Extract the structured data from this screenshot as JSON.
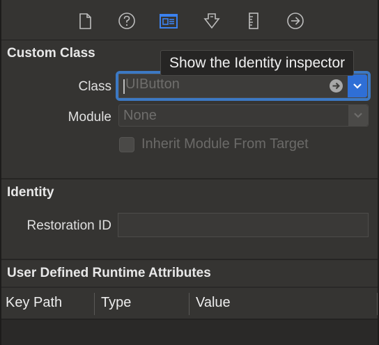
{
  "tabs": {
    "file_inspector": "file-icon",
    "quick_help": "help-icon",
    "identity_inspector": "identity-icon",
    "attributes_inspector": "attributes-icon",
    "size_inspector": "ruler-icon",
    "connections_inspector": "arrow-circle-icon"
  },
  "tooltip": "Show the Identity inspector",
  "custom_class": {
    "title": "Custom Class",
    "class_label": "Class",
    "class_placeholder": "UIButton",
    "module_label": "Module",
    "module_placeholder": "None",
    "inherit_label": "Inherit Module From Target",
    "inherit_checked": false
  },
  "identity": {
    "title": "Identity",
    "restoration_label": "Restoration ID",
    "restoration_value": ""
  },
  "runtime_attributes": {
    "title": "User Defined Runtime Attributes",
    "columns": [
      "Key Path",
      "Type",
      "Value"
    ]
  },
  "colors": {
    "accent": "#2f6fd6",
    "selected_tab": "#3b82f0",
    "background": "#353432"
  }
}
